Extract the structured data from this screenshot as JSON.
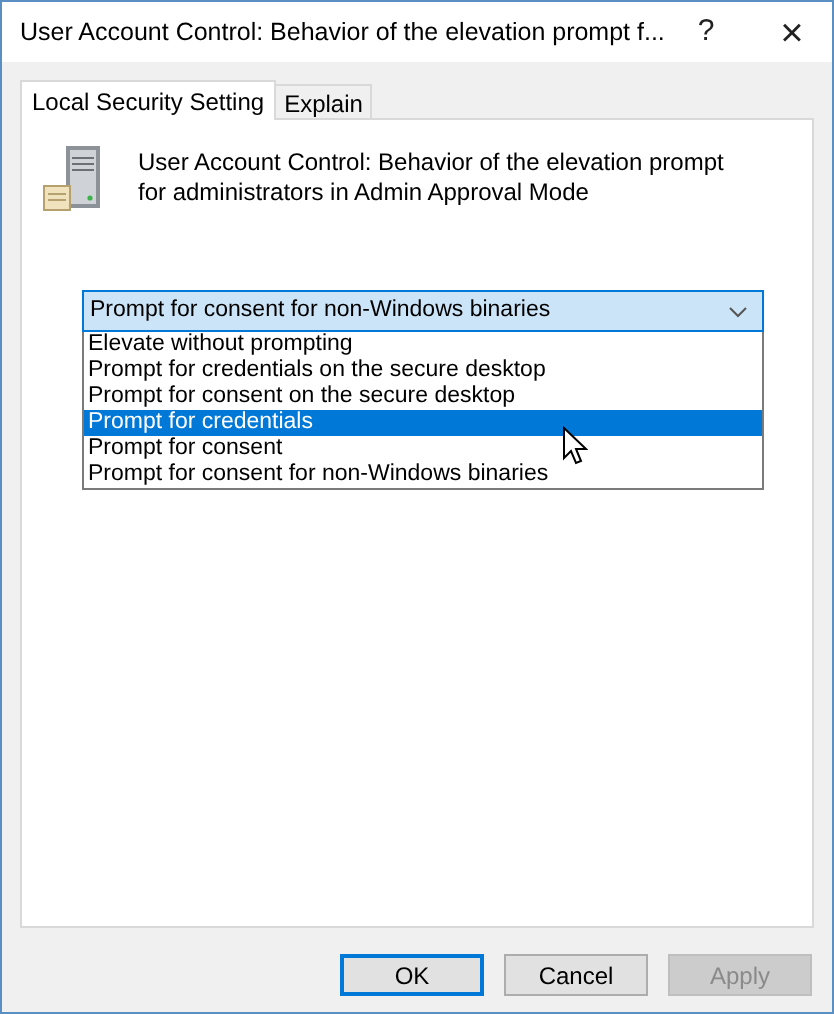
{
  "window": {
    "title": "User Account Control: Behavior of the elevation prompt f...",
    "help": "?",
    "close": "×"
  },
  "tabs": [
    {
      "label": "Local Security Setting",
      "selected": true
    },
    {
      "label": "Explain",
      "selected": false
    }
  ],
  "policy": {
    "description": "User Account Control: Behavior of the elevation prompt for administrators in Admin Approval Mode"
  },
  "dropdown": {
    "value": "Prompt for consent for non-Windows binaries",
    "expanded": true,
    "options": [
      {
        "label": "Elevate without prompting",
        "highlighted": false
      },
      {
        "label": "Prompt for credentials on the secure desktop",
        "highlighted": false
      },
      {
        "label": "Prompt for consent on the secure desktop",
        "highlighted": false
      },
      {
        "label": "Prompt for credentials",
        "highlighted": true
      },
      {
        "label": "Prompt for consent",
        "highlighted": false
      },
      {
        "label": "Prompt for consent for non-Windows binaries",
        "highlighted": false
      }
    ]
  },
  "buttons": [
    {
      "label": "OK",
      "default": true,
      "disabled": false
    },
    {
      "label": "Cancel",
      "default": false,
      "disabled": false
    },
    {
      "label": "Apply",
      "default": false,
      "disabled": true
    }
  ]
}
